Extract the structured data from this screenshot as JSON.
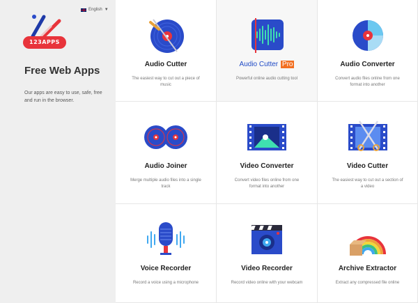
{
  "lang": "English",
  "brand": {
    "logo_text": "123APPS"
  },
  "sidebar": {
    "title": "Free Web Apps",
    "description": "Our apps are easy to use, safe, free and run in the browser."
  },
  "apps": [
    {
      "name": "Audio Cutter",
      "desc": "The easiest way to cut out a piece of music",
      "icon": "audio-cutter-icon"
    },
    {
      "name": "Audio Cutter",
      "badge": "Pro",
      "desc": "Powerful online audio cutting tool",
      "icon": "audio-cutter-pro-icon"
    },
    {
      "name": "Audio Converter",
      "desc": "Convert audio files online from one format into another",
      "icon": "audio-converter-icon"
    },
    {
      "name": "Audio Joiner",
      "desc": "Merge multiple audio files into a single track",
      "icon": "audio-joiner-icon"
    },
    {
      "name": "Video Converter",
      "desc": "Convert video files online from one format into another",
      "icon": "video-converter-icon"
    },
    {
      "name": "Video Cutter",
      "desc": "The easiest way to cut out a section of a video",
      "icon": "video-cutter-icon"
    },
    {
      "name": "Voice Recorder",
      "desc": "Record a voice using a microphone",
      "icon": "microphone-icon"
    },
    {
      "name": "Video Recorder",
      "desc": "Record video online with your webcam",
      "icon": "video-recorder-icon"
    },
    {
      "name": "Archive Extractor",
      "desc": "Extract any compressed file online",
      "icon": "archive-extractor-icon"
    }
  ],
  "colors": {
    "brand_red": "#e8343b",
    "icon_blue": "#2a4bc9",
    "pro_orange": "#f26f21"
  }
}
